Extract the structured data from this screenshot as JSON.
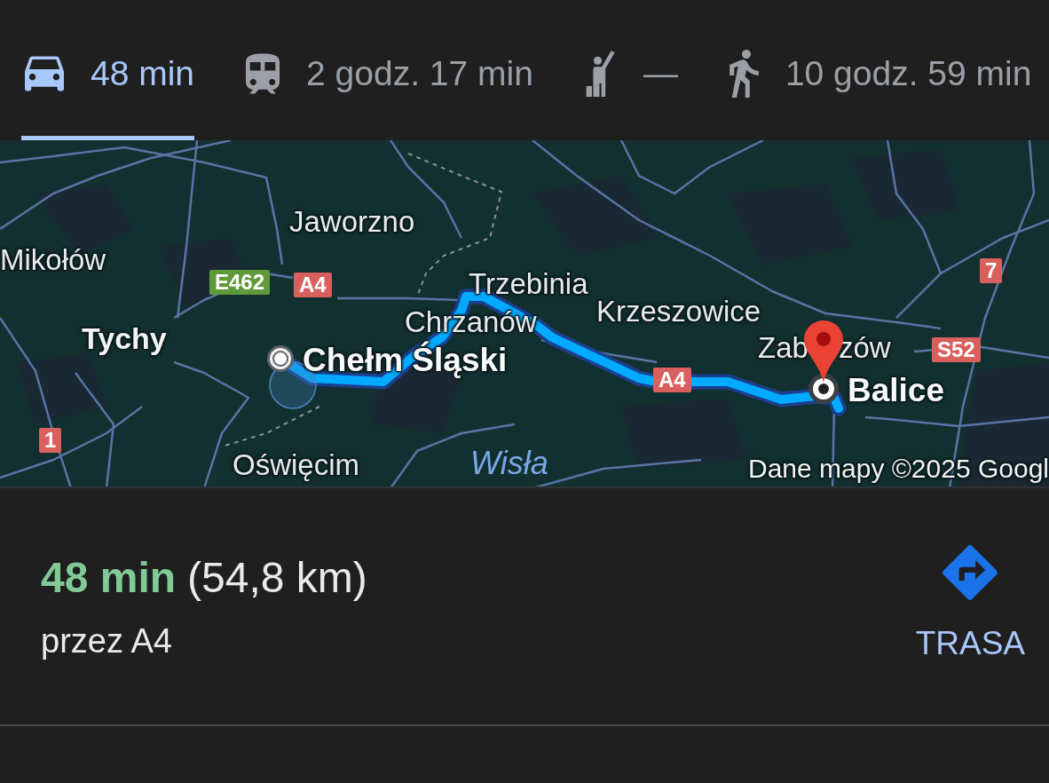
{
  "travel_modes": [
    {
      "kind": "car",
      "label": "48 min",
      "selected": true
    },
    {
      "kind": "transit",
      "label": "2 godz. 17 min",
      "selected": false
    },
    {
      "kind": "ride",
      "label": "—",
      "selected": false
    },
    {
      "kind": "walk",
      "label": "10 godz. 59 min",
      "selected": false
    }
  ],
  "map": {
    "places": [
      {
        "kind": "city",
        "name": "Jaworzno"
      },
      {
        "kind": "city",
        "name": "Mikołów"
      },
      {
        "kind": "city",
        "name": "Trzebinia"
      },
      {
        "kind": "city",
        "name": "Krzeszowice"
      },
      {
        "kind": "city",
        "name": "Chrzanów"
      },
      {
        "kind": "major",
        "name": "Tychy"
      },
      {
        "kind": "endpoint",
        "name": "Chełm Śląski"
      },
      {
        "kind": "city",
        "name": "Zab"
      },
      {
        "kind": "city",
        "name": "zów"
      },
      {
        "kind": "endpoint",
        "name": "Balice"
      },
      {
        "kind": "city",
        "name": "Oświęcim"
      },
      {
        "kind": "water",
        "name": "Wisła"
      }
    ],
    "road_shields": [
      {
        "text": "7",
        "color": "#d9605c"
      },
      {
        "text": "E462",
        "color": "#5f9a3a"
      },
      {
        "text": "A4",
        "color": "#d9605c"
      },
      {
        "text": "S52",
        "color": "#d9605c"
      },
      {
        "text": "A4",
        "color": "#d9605c"
      },
      {
        "text": "1",
        "color": "#d9605c"
      }
    ],
    "attribution": "Dane mapy ©2025 Googl"
  },
  "route_summary": {
    "duration": "48 min",
    "distance": "(54,8 km)",
    "via": "przez A4",
    "action": "TRASA"
  }
}
